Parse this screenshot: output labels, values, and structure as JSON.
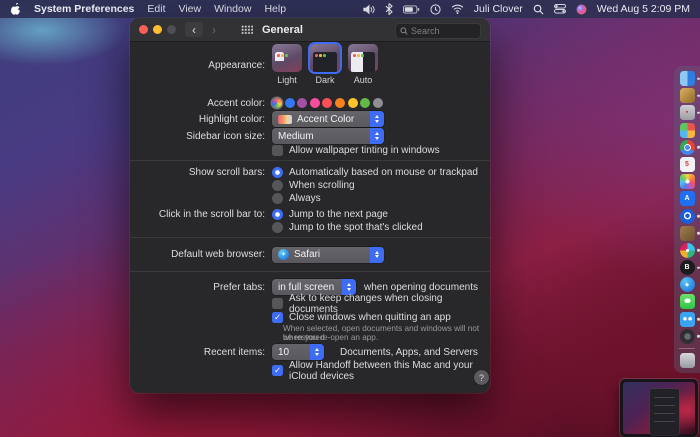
{
  "menu_bar": {
    "app_name": "System Preferences",
    "menus": [
      "Edit",
      "View",
      "Window",
      "Help"
    ],
    "status_icons_left": [
      "volume-icon",
      "bluetooth-icon",
      "battery-icon",
      "time-machine-icon",
      "wifi-icon"
    ],
    "user_name": "Juli Clover",
    "status_icons_right": [
      "spotlight-icon",
      "control-center-icon",
      "siri-icon"
    ],
    "clock": "Wed Aug 5 2:09 PM"
  },
  "window": {
    "title": "General",
    "search_placeholder": "Search",
    "help_label": "?"
  },
  "panel": {
    "appearance": {
      "label": "Appearance:",
      "options": [
        {
          "label": "Light",
          "selected": false
        },
        {
          "label": "Dark",
          "selected": true
        },
        {
          "label": "Auto",
          "selected": false
        }
      ]
    },
    "accent": {
      "label": "Accent color:",
      "colors": [
        {
          "name": "multicolor",
          "css": "conic-gradient(#f56565,#f7a23b,#f7d038,#68c158,#3478f6,#9b59d0,#f56565)",
          "selected": true
        },
        {
          "name": "blue",
          "css": "#3478f6",
          "selected": false
        },
        {
          "name": "purple",
          "css": "#a550a7",
          "selected": false
        },
        {
          "name": "pink",
          "css": "#f74f9e",
          "selected": false
        },
        {
          "name": "red",
          "css": "#fc5058",
          "selected": false
        },
        {
          "name": "orange",
          "css": "#f7821b",
          "selected": false
        },
        {
          "name": "yellow",
          "css": "#fdc129",
          "selected": false
        },
        {
          "name": "green",
          "css": "#62ba46",
          "selected": false
        },
        {
          "name": "graphite",
          "css": "#8e8e93",
          "selected": false
        }
      ]
    },
    "highlight": {
      "label": "Highlight color:",
      "value": "Accent Color"
    },
    "sidebar_size": {
      "label": "Sidebar icon size:",
      "value": "Medium"
    },
    "wallpaper_tint": {
      "label": "Allow wallpaper tinting in windows",
      "checked": false
    },
    "scroll_bars": {
      "label": "Show scroll bars:",
      "options": [
        {
          "label": "Automatically based on mouse or trackpad",
          "selected": true
        },
        {
          "label": "When scrolling",
          "selected": false
        },
        {
          "label": "Always",
          "selected": false
        }
      ]
    },
    "scroll_click": {
      "label": "Click in the scroll bar to:",
      "options": [
        {
          "label": "Jump to the next page",
          "selected": true
        },
        {
          "label": "Jump to the spot that's clicked",
          "selected": false
        }
      ]
    },
    "browser": {
      "label": "Default web browser:",
      "value": "Safari"
    },
    "prefer_tabs": {
      "label": "Prefer tabs:",
      "value": "in full screen",
      "suffix": "when opening documents"
    },
    "ask_keep_changes": {
      "label": "Ask to keep changes when closing documents",
      "checked": false
    },
    "close_windows": {
      "label": "Close windows when quitting an app",
      "checked": true,
      "note_line1": "When selected, open documents and windows will not be restored",
      "note_line2": "when you re-open an app."
    },
    "recent_items": {
      "label": "Recent items:",
      "value": "10",
      "suffix": "Documents, Apps, and Servers"
    },
    "handoff": {
      "label": "Allow Handoff between this Mac and your iCloud devices",
      "checked": true
    }
  },
  "dock": {
    "items": [
      {
        "name": "finder",
        "css": "linear-gradient(90deg,#8ec8f2 50%,#2e7de0 50%)",
        "shape": "square",
        "running": true
      },
      {
        "name": "gold-app",
        "css": "linear-gradient(135deg,#d9b25f,#8f6a2a)",
        "shape": "square",
        "running": true
      },
      {
        "name": "clipboard-app",
        "css": "linear-gradient(180deg,#cfcfd4,#9d9da4)",
        "shape": "square",
        "glyph": "▪",
        "glyph_color": "#c03a3a",
        "running": true
      },
      {
        "name": "launchpad",
        "css": "conic-gradient(#e8554d 0 90deg,#f5b63f 0 180deg,#52b7f0 0 270deg,#5fc45f 0 360deg)",
        "shape": "square",
        "running": false
      },
      {
        "name": "chrome",
        "css": "radial-gradient(circle at 50% 50%,#4a8df0 0 2.4px,#fff 2.4px 3.4px,transparent 3.4px),conic-gradient(#ea4335 0 120deg,#4285f4 0 240deg,#34a853 0 360deg)",
        "shape": "circle",
        "running": true
      },
      {
        "name": "calendar",
        "css": "#f2f2f4",
        "shape": "square",
        "glyph": "5",
        "glyph_color": "#d33b30",
        "running": false
      },
      {
        "name": "photos",
        "css": "radial-gradient(circle at 50% 50%,#fff 0 2px,transparent 2px),conic-gradient(#f7d23e,#f08a3c,#ec5467,#b85ccc,#4f7ce8,#52c1ef,#6cc85e,#f7d23e)",
        "shape": "square",
        "running": false
      },
      {
        "name": "app-store",
        "css": "#1f6ff2",
        "shape": "square",
        "glyph": "A",
        "glyph_color": "#ffffff",
        "running": false
      },
      {
        "name": "onepassword",
        "css": "radial-gradient(circle at 50% 45%,#1a5edb 0 2px,#fff 2.4px 3.4px,#1a5edb 3.8px)",
        "shape": "circle",
        "running": true
      },
      {
        "name": "box-app",
        "css": "linear-gradient(135deg,#a07c50,#6b4f30)",
        "shape": "square",
        "running": true
      },
      {
        "name": "slack",
        "css": "radial-gradient(circle at 50% 50%,#fff 0 1.6px,transparent 1.6px),conic-gradient(#36c5f0 0 90deg,#2eb67d 0 180deg,#ecb22e 0 270deg,#e01e5a 0 360deg)",
        "shape": "circle",
        "running": true
      },
      {
        "name": "bear-app",
        "css": "#1c1c1e",
        "shape": "circle",
        "glyph": "B",
        "glyph_color": "#ffffff",
        "running": true
      },
      {
        "name": "safari",
        "css": "radial-gradient(circle at 35% 30%,#59c8f5,#1565d8)",
        "shape": "circle",
        "glyph": "◆",
        "glyph_color": "#ffffff",
        "running": false
      },
      {
        "name": "messages",
        "css": "radial-gradient(ellipse 5px 4px at 50% 45%,#fff 60%,transparent 61%),linear-gradient(180deg,#6be06a,#2fc544)",
        "shape": "square",
        "running": false
      },
      {
        "name": "tweetbot",
        "css": "radial-gradient(circle at 33% 45%,#fff 0 1.6px,transparent 2px),radial-gradient(circle at 67% 45%,#fff 0 1.6px,transparent 2px),#3aa3f2",
        "shape": "square",
        "running": true
      },
      {
        "name": "camera-app",
        "css": "radial-gradient(circle at 50% 50%,#6a6a70 0 3px,#2e2e33 3.4px)",
        "shape": "circle",
        "running": true
      },
      {
        "divider": true
      },
      {
        "name": "trash",
        "css": "linear-gradient(180deg,#d8d8dc,#9a9aa2)",
        "shape": "square",
        "running": false
      }
    ]
  },
  "colors": {
    "accent_blue": "#3e6cf5",
    "window_bg": "#28282a",
    "titlebar_bg": "#323234",
    "menu_bar_bg": "#2e3052",
    "traffic_close": "#ff5f57",
    "traffic_min": "#febc2e"
  }
}
